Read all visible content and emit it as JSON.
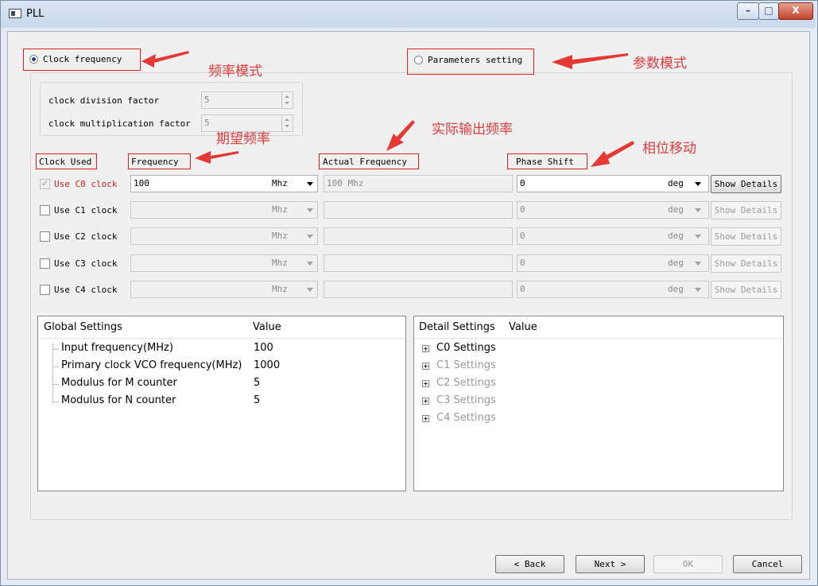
{
  "window": {
    "title": "PLL",
    "controls": [
      "–",
      "□",
      "X"
    ]
  },
  "mode": {
    "clock_frequency_label": "Clock frequency",
    "parameters_setting_label": "Parameters setting"
  },
  "factors": {
    "division_label": "clock division factor",
    "division_value": "5",
    "multiplication_label": "clock multiplication factor",
    "multiplication_value": "5"
  },
  "headers": {
    "clock_used": "Clock Used",
    "frequency": "Frequency",
    "actual_frequency": "Actual Frequency",
    "phase_shift": "Phase Shift"
  },
  "clocks": [
    {
      "label": "Use C0 clock",
      "freq": "100",
      "unit": "Mhz",
      "actual": "100 Mhz",
      "phase": "0",
      "phase_unit": "deg",
      "details": "Show Details"
    },
    {
      "label": "Use C1 clock",
      "freq": "",
      "unit": "Mhz",
      "actual": "",
      "phase": "0",
      "phase_unit": "deg",
      "details": "Show Details"
    },
    {
      "label": "Use C2 clock",
      "freq": "",
      "unit": "Mhz",
      "actual": "",
      "phase": "0",
      "phase_unit": "deg",
      "details": "Show Details"
    },
    {
      "label": "Use C3 clock",
      "freq": "",
      "unit": "Mhz",
      "actual": "",
      "phase": "0",
      "phase_unit": "deg",
      "details": "Show Details"
    },
    {
      "label": "Use C4 clock",
      "freq": "",
      "unit": "Mhz",
      "actual": "",
      "phase": "0",
      "phase_unit": "deg",
      "details": "Show Details"
    }
  ],
  "global_settings": {
    "col1": "Global Settings",
    "col2": "Value",
    "rows": [
      {
        "name": "Input frequency(MHz)",
        "value": "100"
      },
      {
        "name": "Primary clock VCO frequency(MHz)",
        "value": "1000"
      },
      {
        "name": "Modulus for M counter",
        "value": "5"
      },
      {
        "name": "Modulus for N counter",
        "value": "5"
      }
    ]
  },
  "detail_settings": {
    "col1": "Detail Settings",
    "col2": "Value",
    "rows": [
      "C0 Settings",
      "C1 Settings",
      "C2 Settings",
      "C3 Settings",
      "C4 Settings"
    ]
  },
  "footer": {
    "back": "< Back",
    "next": "Next >",
    "ok": "OK",
    "cancel": "Cancel"
  },
  "annotations": {
    "freq_mode": "频率模式",
    "param_mode": "参数模式",
    "desired_freq": "期望频率",
    "actual_output": "实际输出频率",
    "phase_move": "相位移动"
  },
  "colors": {
    "annotation_red": "#e03a3a",
    "enabled_label_red": "#d42020"
  }
}
